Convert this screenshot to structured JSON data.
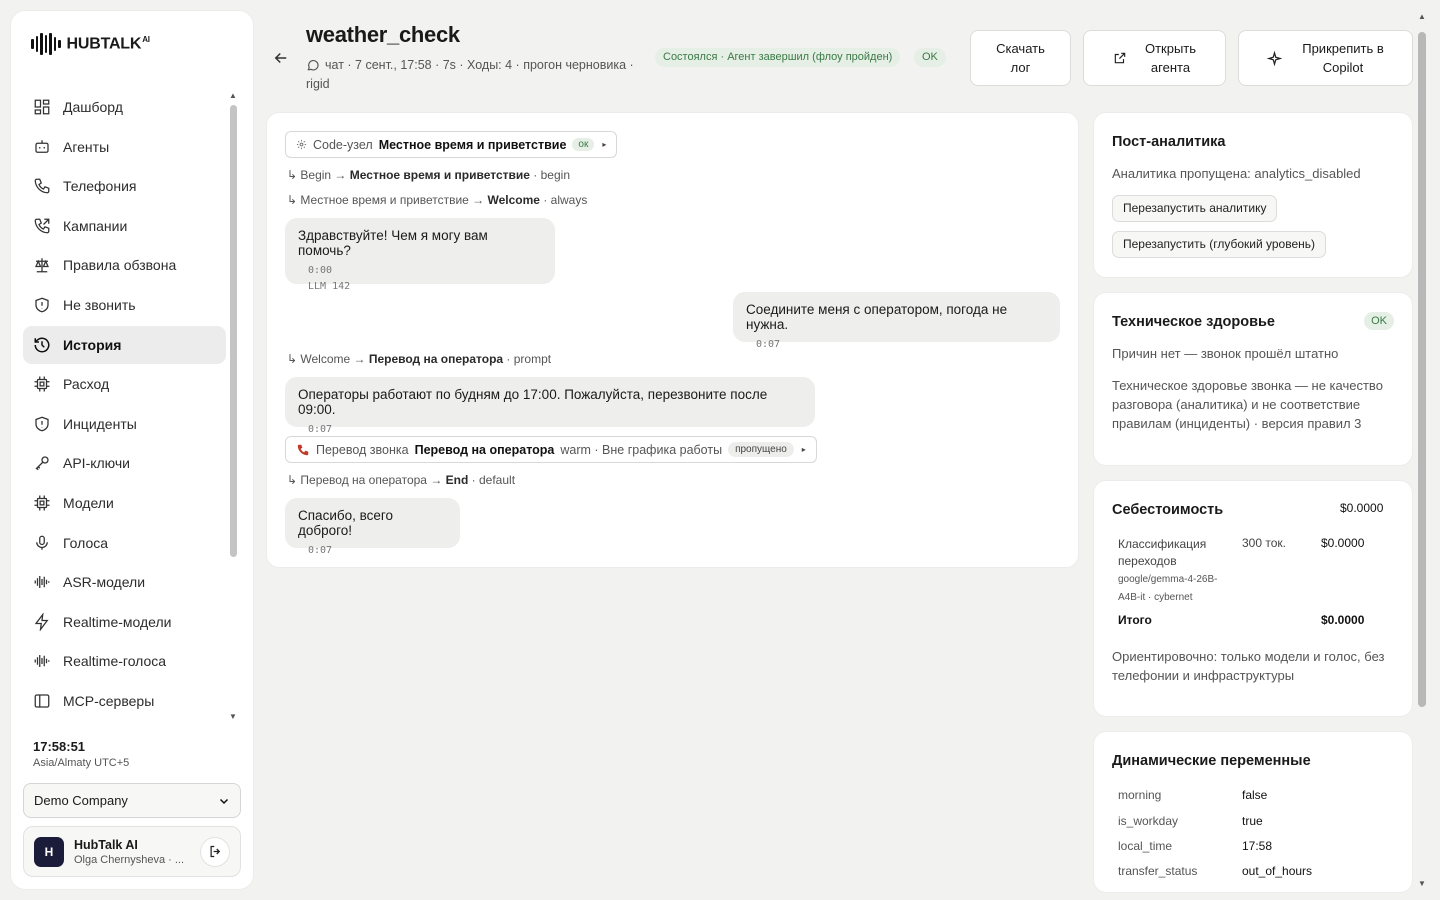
{
  "brand": {
    "name": "HUBTALK",
    "suffix": "AI"
  },
  "sidebar": {
    "items": [
      {
        "label": "Дашборд",
        "icon": "dashboard-icon"
      },
      {
        "label": "Агенты",
        "icon": "robot-icon"
      },
      {
        "label": "Телефония",
        "icon": "phone-icon"
      },
      {
        "label": "Кампании",
        "icon": "phone-outgoing-icon"
      },
      {
        "label": "Правила обзвона",
        "icon": "scales-icon"
      },
      {
        "label": "Не звонить",
        "icon": "shield-icon"
      },
      {
        "label": "История",
        "icon": "history-icon",
        "active": true
      },
      {
        "label": "Расход",
        "icon": "chip-icon"
      },
      {
        "label": "Инциденты",
        "icon": "shield-alert-icon"
      },
      {
        "label": "API-ключи",
        "icon": "key-icon"
      },
      {
        "label": "Модели",
        "icon": "chip-icon"
      },
      {
        "label": "Голоса",
        "icon": "mic-icon"
      },
      {
        "label": "ASR-модели",
        "icon": "waveform-icon"
      },
      {
        "label": "Realtime-модели",
        "icon": "bolt-icon"
      },
      {
        "label": "Realtime-голоса",
        "icon": "waveform-icon"
      },
      {
        "label": "MCP-серверы",
        "icon": "panel-icon"
      }
    ],
    "clock": {
      "time": "17:58:51",
      "timezone": "Asia/Almaty UTC+5"
    },
    "company": "Demo Company",
    "user": {
      "initial": "H",
      "name": "HubTalk AI",
      "email": "Olga Chernysheva · ..."
    }
  },
  "header": {
    "title": "weather_check",
    "meta_channel": "чат",
    "meta_rest": "· 7 сент., 17:58 · 7s · Ходы: 4 · прогон черновика ·",
    "meta_mode": "rigid",
    "status": "Состоялся · Агент завершил (флоу пройден)",
    "ok": "OK",
    "buttons": {
      "download_1": "Скачать",
      "download_2": "лог",
      "open_1": "Открыть",
      "open_2": "агента",
      "pin_1": "Прикрепить в",
      "pin_2": "Copilot"
    }
  },
  "conversation": {
    "node1": {
      "type": "Code-узел",
      "name": "Местное время и приветствие",
      "badge": "ок"
    },
    "t1": {
      "from": "Begin",
      "to": "Местное время и приветствие",
      "cond": "· begin"
    },
    "t2": {
      "from": "Местное время и приветствие",
      "to": "Welcome",
      "cond": "· always"
    },
    "m1": {
      "text": "Здравствуйте! Чем я могу вам помочь?",
      "time": "0:00",
      "extra": "LLM 142"
    },
    "m2": {
      "text": "Соедините меня с оператором, погода не нужна.",
      "time": "0:07"
    },
    "t3": {
      "from": "Welcome",
      "to": "Перевод на оператора",
      "cond": "· prompt"
    },
    "m3": {
      "text": "Операторы работают по будням до 17:00. Пожалуйста, перезвоните после 09:00.",
      "time": "0:07"
    },
    "node2": {
      "type": "Перевод звонка",
      "name": "Перевод на оператора",
      "detail": "warm · Вне графика работы",
      "badge": "пропущено"
    },
    "t4": {
      "from": "Перевод на оператора",
      "to": "End",
      "cond": "· default"
    },
    "m4": {
      "text": "Спасибо, всего доброго!",
      "time": "0:07"
    }
  },
  "analytics": {
    "title": "Пост-аналитика",
    "text": "Аналитика пропущена: analytics_disabled",
    "btn1": "Перезапустить аналитику",
    "btn2": "Перезапустить (глубокий уровень)"
  },
  "health": {
    "title": "Техническое здоровье",
    "badge": "OK",
    "reason": "Причин нет — звонок прошёл штатно",
    "note": "Техническое здоровье звонка — не качество разговора (аналитика) и не соответствие правилам (инциденты) · версия правил 3"
  },
  "cost": {
    "title": "Себестоимость",
    "total_top": "$0.0000",
    "item_name_1": "Классификация",
    "item_name_2": "переходов",
    "item_model_1": "google/gemma-4-26B-",
    "item_model_2": "A4B-it · cybernet",
    "item_tokens": "300 ток.",
    "item_cost": "$0.0000",
    "total_label": "Итого",
    "total_value": "$0.0000",
    "note": "Ориентировочно: только модели и голос, без телефонии и инфраструктуры"
  },
  "variables": {
    "title": "Динамические переменные",
    "rows": [
      {
        "k": "morning",
        "v": "false"
      },
      {
        "k": "is_workday",
        "v": "true"
      },
      {
        "k": "local_time",
        "v": "17:58"
      },
      {
        "k": "transfer_status",
        "v": "out_of_hours"
      }
    ]
  }
}
